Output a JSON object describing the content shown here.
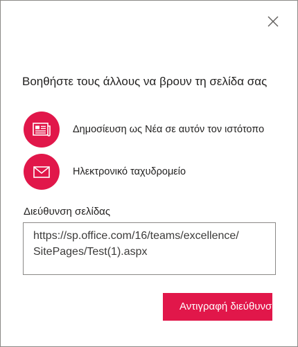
{
  "dialog": {
    "title": "Βοηθήστε τους άλλους να βρουν τη σελίδα σας",
    "close_icon": "close-icon"
  },
  "share_options": [
    {
      "label": "Δημοσίευση ως Νέα σε αυτόν τον ιστότοπο",
      "icon": "news-icon"
    },
    {
      "label": "Ηλεκτρονικό ταχυδρομείο",
      "icon": "mail-icon"
    }
  ],
  "page_address": {
    "label": "Διεύθυνση σελίδας",
    "line1": "https://sp.office.com/16/teams/excellence/",
    "line2": "SitePages/Test(1).aspx"
  },
  "copy_button": {
    "label": "Αντιγραφή διεύθυνσης"
  },
  "colors": {
    "accent": "#e1174a",
    "text": "#201f1e",
    "border": "#8a8886"
  }
}
